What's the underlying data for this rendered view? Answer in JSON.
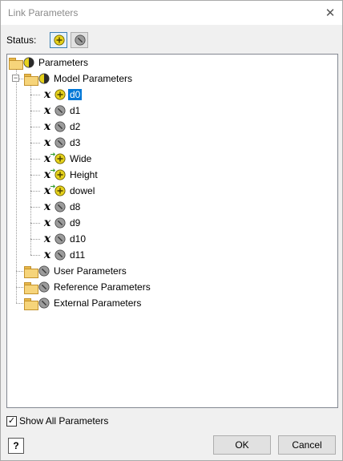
{
  "window": {
    "title": "Link Parameters",
    "close_glyph": "✕"
  },
  "status": {
    "label": "Status:",
    "buttons": [
      {
        "icon": "linked-status-icon",
        "state": "pressed"
      },
      {
        "icon": "unlinked-status-icon",
        "state": "normal"
      }
    ]
  },
  "tree": {
    "root": {
      "label": "Parameters",
      "icon": "mixed-status-icon"
    },
    "model": {
      "label": "Model Parameters",
      "icon": "mixed-status-icon",
      "expander": "−"
    },
    "model_items": [
      {
        "label": "d0",
        "type": "model",
        "status": "linked",
        "selected": true
      },
      {
        "label": "d1",
        "type": "model",
        "status": "unlinked",
        "selected": false
      },
      {
        "label": "d2",
        "type": "model",
        "status": "unlinked",
        "selected": false
      },
      {
        "label": "d3",
        "type": "model",
        "status": "unlinked",
        "selected": false
      },
      {
        "label": "Wide",
        "type": "user",
        "status": "linked",
        "selected": false
      },
      {
        "label": "Height",
        "type": "user",
        "status": "linked",
        "selected": false
      },
      {
        "label": "dowel",
        "type": "user",
        "status": "linked",
        "selected": false
      },
      {
        "label": "d8",
        "type": "model",
        "status": "unlinked",
        "selected": false
      },
      {
        "label": "d9",
        "type": "model",
        "status": "unlinked",
        "selected": false
      },
      {
        "label": "d10",
        "type": "model",
        "status": "unlinked",
        "selected": false
      },
      {
        "label": "d11",
        "type": "model",
        "status": "unlinked",
        "selected": false
      }
    ],
    "groups": [
      {
        "label": "User Parameters",
        "status": "unlinked"
      },
      {
        "label": "Reference Parameters",
        "status": "unlinked"
      },
      {
        "label": "External Parameters",
        "status": "unlinked"
      }
    ]
  },
  "show_all": {
    "label": "Show All Parameters",
    "checked": true,
    "check_glyph": "✓"
  },
  "buttons": {
    "help_glyph": "?",
    "ok": "OK",
    "cancel": "Cancel"
  },
  "colors": {
    "linked_fill": "#e6d21c",
    "unlinked_fill": "#9c9c9c",
    "selection": "#0078d7"
  }
}
